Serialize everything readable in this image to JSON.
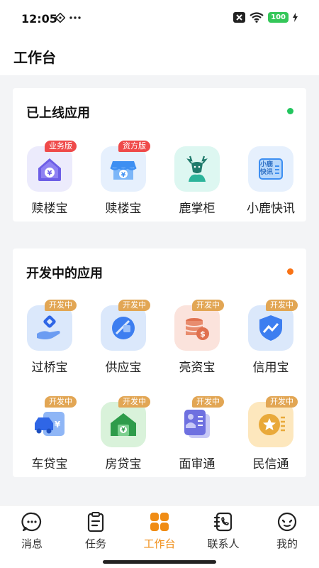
{
  "status_bar": {
    "time": "12:05",
    "battery": "100",
    "icons": [
      "location-diamond-icon",
      "more-dots-icon",
      "notification-x-icon",
      "wifi-icon",
      "battery-icon",
      "charging-icon"
    ]
  },
  "header": {
    "title": "工作台"
  },
  "online_section": {
    "title": "已上线应用",
    "dot_color": "#22c55e",
    "apps": [
      {
        "label": "赎楼宝",
        "badge": "业务版",
        "icon": "house-yen-icon"
      },
      {
        "label": "赎楼宝",
        "badge": "资方版",
        "icon": "store-yen-icon"
      },
      {
        "label": "鹿掌柜",
        "badge": "",
        "icon": "deer-icon"
      },
      {
        "label": "小鹿快讯",
        "badge": "",
        "icon": "news-card-icon",
        "icon_text": "小鹿快讯"
      }
    ]
  },
  "dev_section": {
    "title": "开发中的应用",
    "dot_color": "#f97316",
    "badge": "开发中",
    "apps": [
      {
        "label": "过桥宝",
        "icon": "hand-coin-icon"
      },
      {
        "label": "供应宝",
        "icon": "supply-circle-icon"
      },
      {
        "label": "亮资宝",
        "icon": "coin-stack-icon"
      },
      {
        "label": "信用宝",
        "icon": "credit-shield-icon"
      },
      {
        "label": "车贷宝",
        "icon": "car-loan-icon"
      },
      {
        "label": "房贷宝",
        "icon": "house-loan-icon"
      },
      {
        "label": "面审通",
        "icon": "interview-cards-icon"
      },
      {
        "label": "民信通",
        "icon": "star-coin-icon"
      }
    ]
  },
  "tab_bar": {
    "active_color": "#f08c14",
    "tabs": [
      {
        "label": "消息",
        "icon": "message-icon"
      },
      {
        "label": "任务",
        "icon": "clipboard-icon"
      },
      {
        "label": "工作台",
        "icon": "grid-icon"
      },
      {
        "label": "联系人",
        "icon": "contacts-icon"
      },
      {
        "label": "我的",
        "icon": "profile-icon"
      }
    ]
  }
}
